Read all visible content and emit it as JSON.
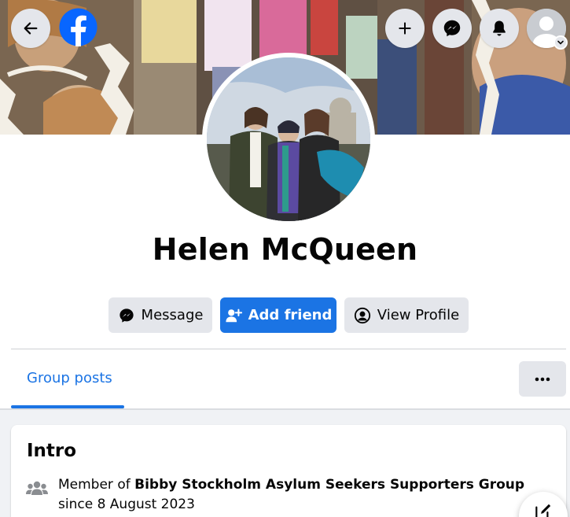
{
  "nav": {
    "back_icon": "arrow-left-icon",
    "logo_icon": "facebook-logo-icon",
    "create_icon": "plus-icon",
    "messenger_icon": "messenger-icon",
    "notifications_icon": "bell-icon",
    "account_icon": "avatar-icon"
  },
  "profile": {
    "name": "Helen McQueen"
  },
  "actions": {
    "message_label": "Message",
    "add_friend_label": "Add friend",
    "view_profile_label": "View Profile"
  },
  "tabs": {
    "active_label": "Group posts",
    "more_icon": "ellipsis-icon"
  },
  "intro": {
    "title": "Intro",
    "prefix": "Member of ",
    "group_name": "Bibby Stockholm Asylum Seekers Supporters Group",
    "suffix": " since 8 August 2023"
  },
  "colors": {
    "brand_blue": "#1b74e4",
    "button_grey": "#e4e6eb",
    "background": "#f0f2f5"
  }
}
